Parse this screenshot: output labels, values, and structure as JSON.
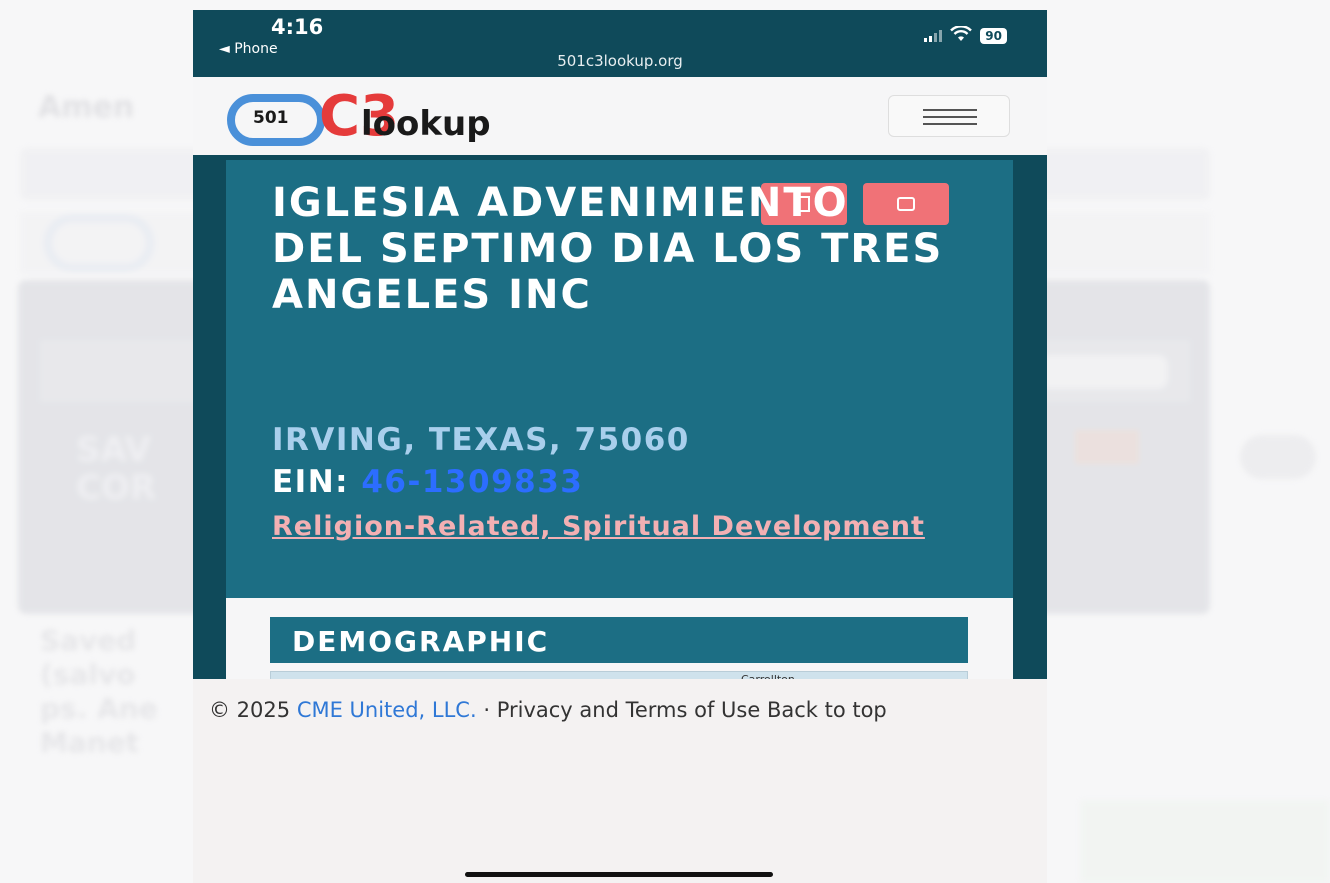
{
  "status_bar": {
    "time": "4:16",
    "back_label": "◄ Phone",
    "url": "501c3lookup.org",
    "battery": "90"
  },
  "navbar": {
    "logo_number": "501",
    "logo_c3": "C3",
    "logo_word": "lookup"
  },
  "org": {
    "name": "IGLESIA ADVENIMIENTO DEL SEPTIMO DIA LOS TRES ANGELES INC",
    "location": "IRVING, TEXAS, 75060",
    "ein_label": "EIN:",
    "ein_value": "46-1309833",
    "category": "Religion-Related, Spiritual Development"
  },
  "section": {
    "title": "DEMOGRAPHIC",
    "map_label": "Carrollton"
  },
  "footer": {
    "copyright": "© 2025",
    "company_link": "CME United, LLC.",
    "separator": "·",
    "privacy_terms": "Privacy and Terms of Use",
    "back_to_top": "Back to top"
  },
  "colors": {
    "header_bg": "#0f4a5a",
    "card_bg": "#1c6e84",
    "button_red": "#f07277",
    "ein_blue": "#2c6dff",
    "location_blue": "#a9cfec",
    "category_pink": "#f3b0b3",
    "footer_link": "#2f78d6"
  },
  "icons": {
    "bookmark": "bookmark-icon",
    "share": "share-icon",
    "menu": "hamburger-menu-icon",
    "wifi": "wifi-icon",
    "signal": "signal-icon",
    "battery": "battery-icon"
  }
}
